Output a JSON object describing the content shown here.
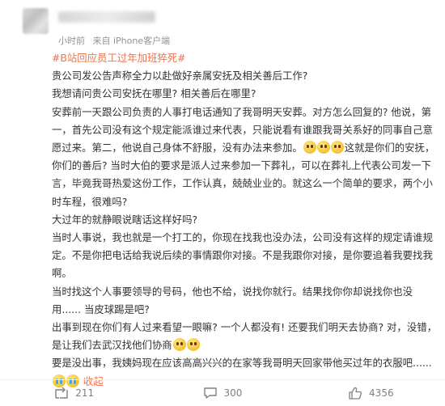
{
  "post": {
    "meta": {
      "time": "小时前",
      "source": "来自 iPhone客户端"
    },
    "hashtag": "#B站回应员工过年加班猝死#",
    "paragraphs": {
      "p1": "贵公司发公告声称全力以赴做好亲属安抚及相关善后工作?",
      "p2": "我想请问贵公司安抚在哪里? 相关善后在哪里?",
      "p3a": "安葬前一天跟公司负责的人事打电话通知了我哥明天安葬。对方怎么回复的? 他说，第一，首先公司没有这个规定能派谁过来代表，只能说看有谁跟我哥关系好的同事自己意愿过来。第二，他说自己身体不舒服，没有办法来参加。",
      "p3b": "这就是你们的安抚，你们的善后? 当时大伯的要求是派人过来参加一下葬礼，可以在葬礼上代表公司发一下言，毕竟我哥热爱这份工作，工作认真，兢兢业业的。就这么一个简单的要求，两个小时车程，很难吗?",
      "p4": "大过年的就静眼说瞎话这样好吗?",
      "p5": "当时人事说，我也就是一个打工的，你现在找我也没办法，公司没有这样的规定请谁规定。不是你把电话给我说后续的事情跟你对接。不是我跟你对接，是你要追着我要找我啊。",
      "p6": "当时找这个人事要领导的号码，他也不给，说找你就行。结果找你你却说找你也没用...... 当皮球踢是吧?",
      "p7a": "出事到现在你们有人过来看望一眼嘛? 一个人都没有! 还要我们明天去协商? 对，没错，是让我们去武汉找他们协商",
      "p8a": "要是没出事，我姨妈现在应该高高兴兴的在家等我哥明天回家带他买过年的衣服吧......"
    },
    "collapse_label": "收起",
    "emojis": {
      "after_p3a": [
        "smile-face",
        "smile-face",
        "smile-face"
      ],
      "after_p7a": [
        "smile-face",
        "smile-face"
      ],
      "end": [
        "cry-face",
        "cry-face"
      ]
    },
    "actions": {
      "repost": {
        "icon": "repost-icon",
        "count": "211"
      },
      "comment": {
        "icon": "comment-icon",
        "count": "300"
      },
      "like": {
        "icon": "like-icon",
        "count": "4356"
      }
    },
    "colors": {
      "accent": "#eb7350",
      "text": "#333333",
      "meta": "#939393"
    }
  }
}
